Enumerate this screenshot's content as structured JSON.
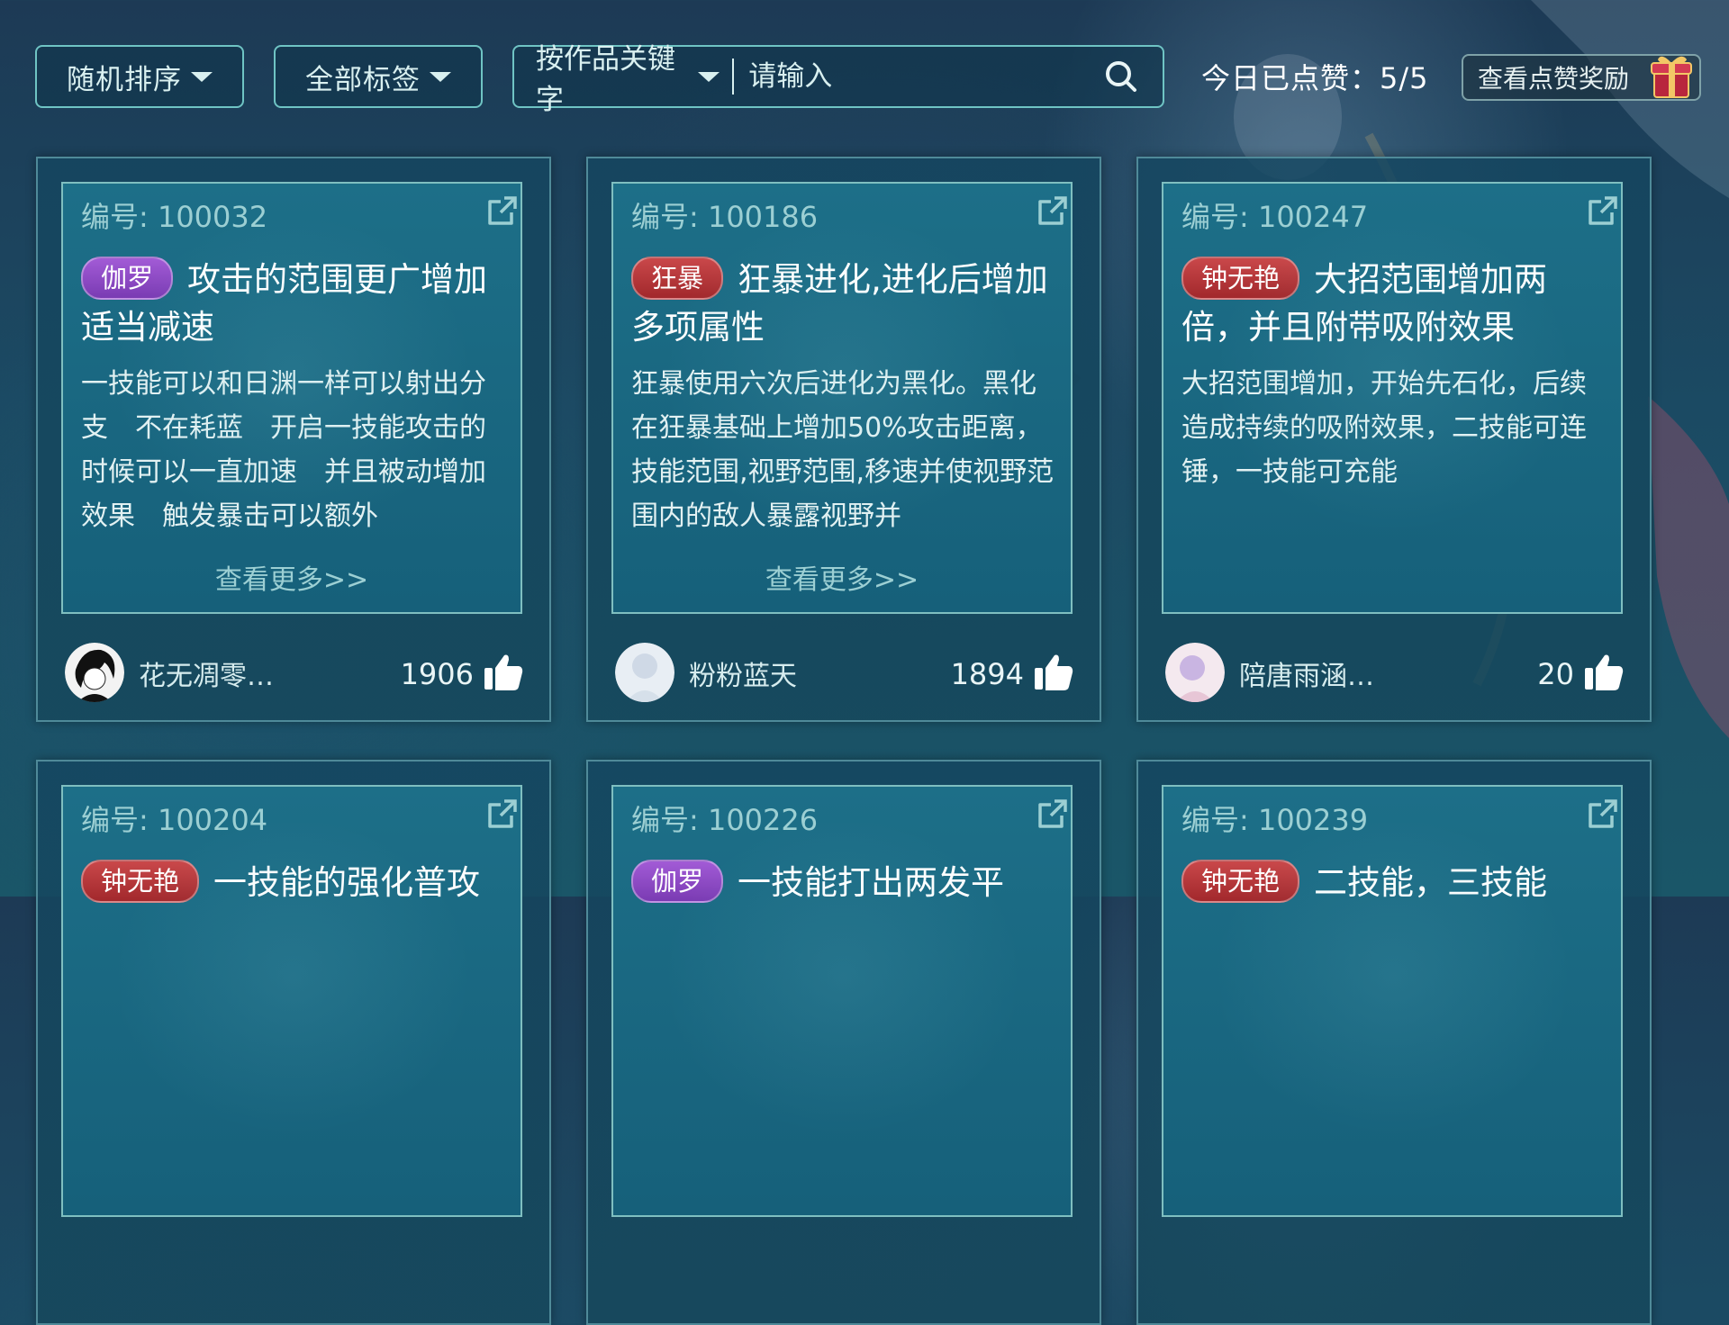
{
  "toolbar": {
    "sort_label": "随机排序",
    "tags_label": "全部标签",
    "search_mode_label": "按作品关键字",
    "search_placeholder": "请输入",
    "likes_today": "今日已点赞：5/5",
    "reward_label": "查看点赞奖励"
  },
  "colors": {
    "accent_border": "#6fc4c4",
    "tag_purple": "#8e48c6",
    "tag_red": "#b5363a"
  },
  "cards": [
    {
      "id": "编号: 100032",
      "tag": "伽罗",
      "tag_color": "purple",
      "title": "攻击的范围更广增加适当减速",
      "desc": "一技能可以和日渊一样可以射出分支　不在耗蓝　开启一技能攻击的时候可以一直加速　并且被动增加效果　触发暴击可以额外",
      "more": "查看更多>>",
      "user": "花无凋零…",
      "likes": "1906"
    },
    {
      "id": "编号: 100186",
      "tag": "狂暴",
      "tag_color": "red",
      "title": "狂暴进化,进化后增加多项属性",
      "desc": "狂暴使用六次后进化为黑化。黑化在狂暴基础上增加50%攻击距离，技能范围,视野范围,移速并使视野范围内的敌人暴露视野并",
      "more": "查看更多>>",
      "user": "粉粉蓝天",
      "likes": "1894"
    },
    {
      "id": "编号: 100247",
      "tag": "钟无艳",
      "tag_color": "red",
      "title": "大招范围增加两倍，并且附带吸附效果",
      "desc": "大招范围增加，开始先石化，后续造成持续的吸附效果，二技能可连锤，一技能可充能",
      "more": "",
      "user": "陪唐雨涵…",
      "likes": "20"
    },
    {
      "id": "编号: 100204",
      "tag": "钟无艳",
      "tag_color": "red",
      "title": "一技能的强化普攻",
      "desc": "",
      "more": "",
      "user": "",
      "likes": ""
    },
    {
      "id": "编号: 100226",
      "tag": "伽罗",
      "tag_color": "purple",
      "title": "一技能打出两发平",
      "desc": "",
      "more": "",
      "user": "",
      "likes": ""
    },
    {
      "id": "编号: 100239",
      "tag": "钟无艳",
      "tag_color": "red",
      "title": "二技能，三技能",
      "desc": "",
      "more": "",
      "user": "",
      "likes": ""
    }
  ]
}
